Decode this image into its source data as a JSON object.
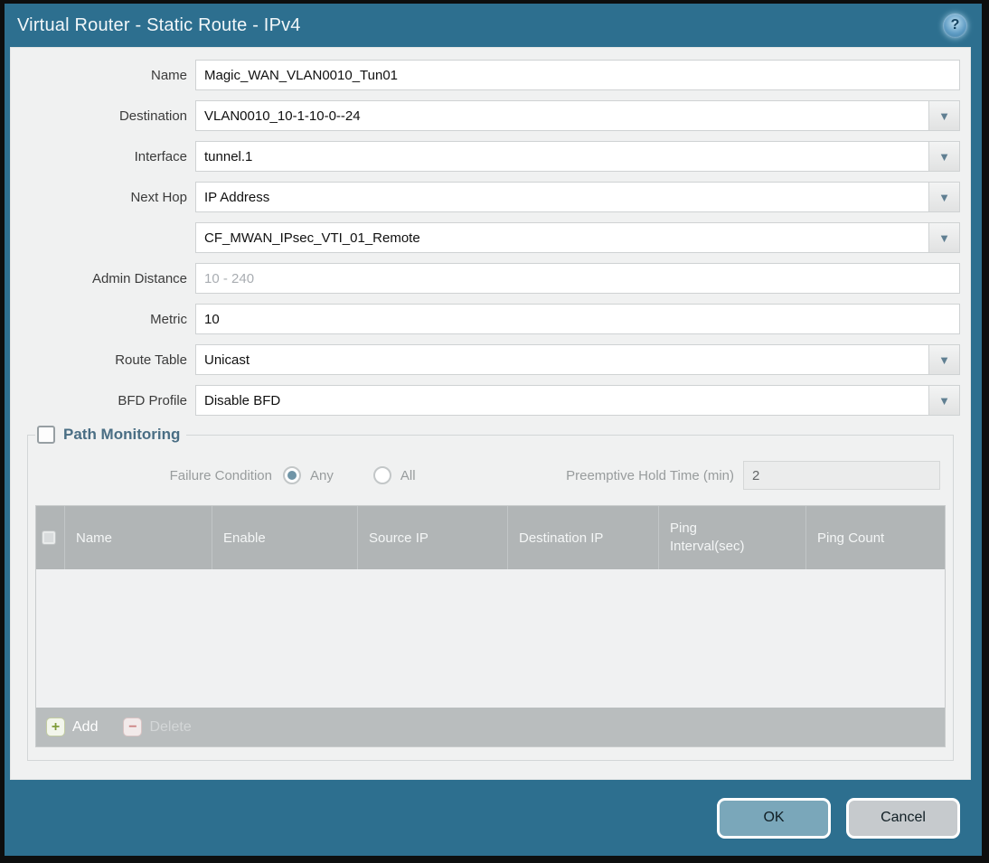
{
  "dialog": {
    "title": "Virtual Router - Static Route - IPv4",
    "ok_label": "OK",
    "cancel_label": "Cancel"
  },
  "icons": {
    "help": "?",
    "chevron": "▼",
    "add": "+",
    "delete": "−"
  },
  "form": {
    "fields": [
      {
        "label": "Name",
        "value": "Magic_WAN_VLAN0010_Tun01",
        "type": "text"
      },
      {
        "label": "Destination",
        "value": "VLAN0010_10-1-10-0--24",
        "type": "dropdown"
      },
      {
        "label": "Interface",
        "value": "tunnel.1",
        "type": "dropdown"
      },
      {
        "label": "Next Hop",
        "value": "IP Address",
        "type": "dropdown"
      },
      {
        "label": "",
        "value": "CF_MWAN_IPsec_VTI_01_Remote",
        "type": "dropdown"
      },
      {
        "label": "Admin Distance",
        "value": "",
        "placeholder": "10 - 240",
        "type": "text"
      },
      {
        "label": "Metric",
        "value": "10",
        "type": "text"
      },
      {
        "label": "Route Table",
        "value": "Unicast",
        "type": "dropdown"
      },
      {
        "label": "BFD Profile",
        "value": "Disable BFD",
        "type": "dropdown"
      }
    ]
  },
  "path_monitoring": {
    "legend": "Path Monitoring",
    "enabled": false,
    "failure_condition_label": "Failure Condition",
    "radio_any_label": "Any",
    "radio_all_label": "All",
    "selected_failure_condition": "Any",
    "hold_time_label": "Preemptive Hold Time (min)",
    "hold_time_value": "2",
    "table": {
      "columns": [
        "Name",
        "Enable",
        "Source IP",
        "Destination IP",
        "Ping Interval(sec)",
        "Ping Count"
      ],
      "rows": []
    },
    "add_label": "Add",
    "delete_label": "Delete"
  },
  "colors": {
    "titlebar": "#2d6f8f",
    "panel_bg": "#f0f1f1",
    "table_header_bg": "#b1b5b6",
    "ok_button": "#7aa7ba",
    "cancel_button": "#c6cacd",
    "legend_text": "#4a6e84",
    "add_icon_green": "#7f9c3a",
    "delete_icon_red": "#cb8080"
  }
}
